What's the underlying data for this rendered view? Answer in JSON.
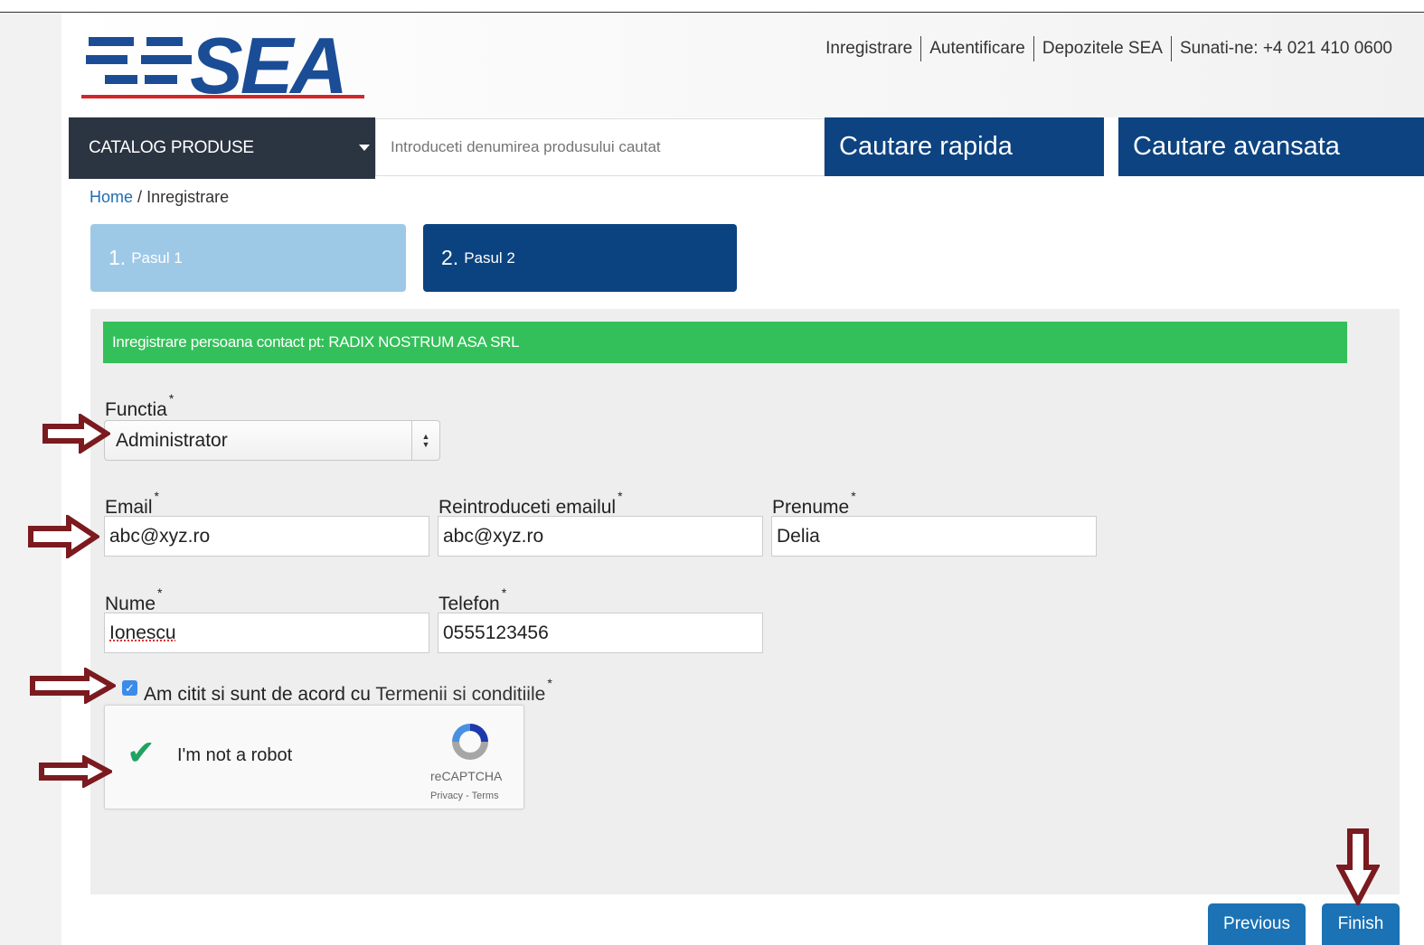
{
  "header": {
    "logo_text": "SEA",
    "links": [
      "Inregistrare",
      "Autentificare",
      "Depozitele SEA",
      "Sunati-ne: +4 021 410 0600"
    ]
  },
  "nav": {
    "catalog_label": "CATALOG PRODUSE",
    "search_placeholder": "Introduceti denumirea produsului cautat",
    "quick_search": "Cautare rapida",
    "advanced_search": "Cautare avansata"
  },
  "breadcrumb": {
    "home": "Home",
    "separator": "/",
    "current": "Inregistrare"
  },
  "steps": [
    {
      "num": "1.",
      "label": "Pasul 1",
      "active": false
    },
    {
      "num": "2.",
      "label": "Pasul 2",
      "active": true
    }
  ],
  "form": {
    "alert": "Inregistrare persoana contact pt: RADIX NOSTRUM ASA SRL",
    "required_mark": "*",
    "functia_label": "Functia",
    "functia_value": "Administrator",
    "email_label": "Email",
    "email_value": "abc@xyz.ro",
    "reemail_label": "Reintroduceti emailul",
    "reemail_value": "abc@xyz.ro",
    "prenume_label": "Prenume",
    "prenume_value": "Delia",
    "nume_label": "Nume",
    "nume_value": "Ionescu",
    "telefon_label": "Telefon",
    "telefon_value": "0555123456",
    "terms_prefix": "Am citit si sunt de acord cu",
    "terms_link": "Termenii si conditiile",
    "terms_checked": true
  },
  "captcha": {
    "text": "I'm not a robot",
    "brand": "reCAPTCHA",
    "links": "Privacy - Terms"
  },
  "actions": {
    "previous": "Previous",
    "finish": "Finish"
  },
  "colors": {
    "primary": "#0d4381",
    "alert_green": "#33c05a",
    "annotation": "#7b1a1f"
  }
}
